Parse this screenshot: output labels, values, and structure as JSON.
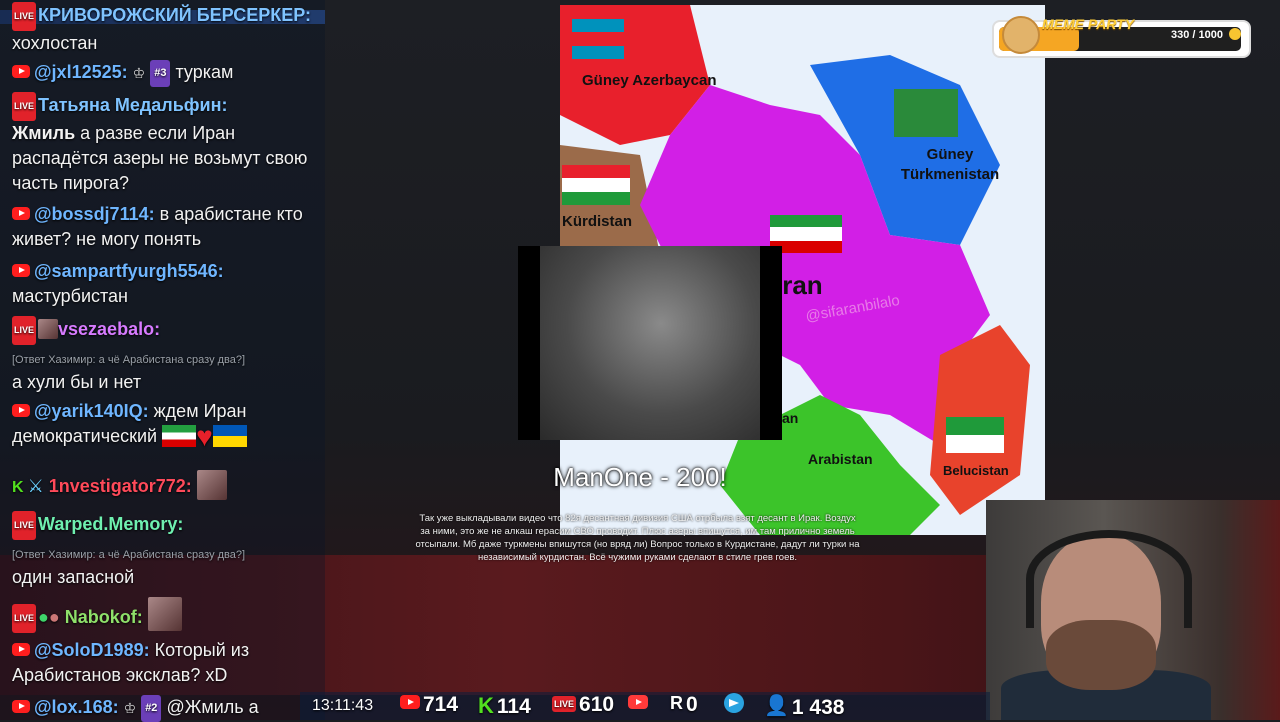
{
  "chat": {
    "messages": [
      {
        "nick": "КРИВОРОЖСКИЙ БЕРСЕРКЕР:",
        "text": "хохлостан"
      },
      {
        "nick": "@jxl12525:",
        "rank": "#3",
        "text": "туркам"
      },
      {
        "nick": "Татьяна Медальфин:",
        "mention": "Жмиль",
        "text": "а разве если Иран распадётся азеры не возьмут свою часть пирога?"
      },
      {
        "nick": "@bossdj7114:",
        "text": "в арабистане кто живет? не могу понять"
      },
      {
        "nick": "@sampartfyurgh5546:",
        "text": "мастурбистан"
      },
      {
        "nick": "vsezaebalo:",
        "reply": "[Ответ Хазимир: а чё Арабистана сразу два?]",
        "text": "а хули бы и нет"
      },
      {
        "nick": "@yarik140IQ:",
        "text": "ждем Иран демократический"
      },
      {
        "nick": "1nvestigator772:"
      },
      {
        "nick": "Warped.Memory:",
        "reply": "[Ответ Хазимир: а чё Арабистана сразу два?]",
        "text": "один запасной"
      },
      {
        "nick": "Nabokof:"
      },
      {
        "nick": "@SoloD1989:",
        "text": "Который из Арабистанов эксклав? xD"
      },
      {
        "nick": "@lox.168:",
        "rank": "#2",
        "text": "@Жмиль а"
      }
    ]
  },
  "map": {
    "labels": [
      "Güney Azerbaycan",
      "Kürdistan",
      "Güney Türkmenistan",
      "İran",
      "@sifaranbilalo",
      "Arabistan",
      "Belucistan",
      "an"
    ],
    "colors": {
      "iran": "#d21fe6",
      "azerbaijan": "#e8202c",
      "turkmenistan": "#1f6ee6",
      "kurdistan": "#9b6b4a",
      "arabistan": "#3cc42a",
      "belucistan": "#e8432c",
      "sea": "#e8f1fb"
    }
  },
  "donation": {
    "title": "ManOne - 200!",
    "text": "Так уже выкладывали видео что 82я десантная дивизия США отрбыла взят десант в Ирак. Воздух за ними, это же не алкаш герасим СВО проводит. Плюс азеры впишутся, им там прилично земель отсыпали. Мб даже туркмены впишутся (но вряд ли) Вопрос только в Курдистане, дадут ли турки на независимый курдистан. Всё чужими руками сделают в стиле грев гоев."
  },
  "meme_party": {
    "title": "MEME PARTY",
    "count": "330 / 1000",
    "progress": 0.33
  },
  "stats": {
    "time": "13:11:43",
    "youtube": "714",
    "kick": "114",
    "live": "610",
    "twitch": "",
    "rutube": "0",
    "total": "1 438"
  }
}
